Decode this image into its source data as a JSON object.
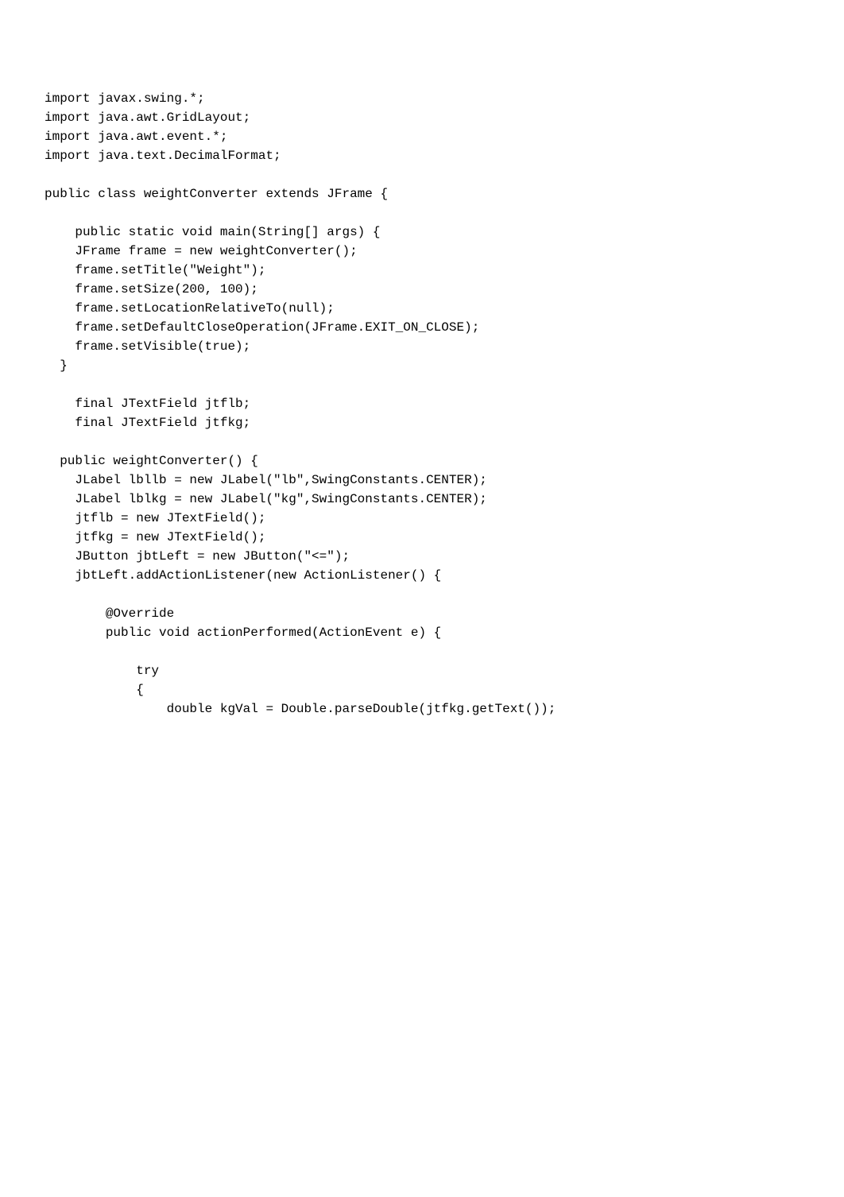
{
  "code": {
    "lines": [
      "import javax.swing.*;",
      "import java.awt.GridLayout;",
      "import java.awt.event.*;",
      "import java.text.DecimalFormat;",
      "",
      "public class weightConverter extends JFrame {",
      "",
      "    public static void main(String[] args) {",
      "    JFrame frame = new weightConverter();",
      "    frame.setTitle(\"Weight\");",
      "    frame.setSize(200, 100);",
      "    frame.setLocationRelativeTo(null);",
      "    frame.setDefaultCloseOperation(JFrame.EXIT_ON_CLOSE);",
      "    frame.setVisible(true);",
      "  }",
      "",
      "    final JTextField jtflb;",
      "    final JTextField jtfkg;",
      "",
      "  public weightConverter() {",
      "    JLabel lbllb = new JLabel(\"lb\",SwingConstants.CENTER);",
      "    JLabel lblkg = new JLabel(\"kg\",SwingConstants.CENTER);",
      "    jtflb = new JTextField();",
      "    jtfkg = new JTextField();",
      "    JButton jbtLeft = new JButton(\"<=\");",
      "    jbtLeft.addActionListener(new ActionListener() {",
      "",
      "        @Override",
      "        public void actionPerformed(ActionEvent e) {",
      "",
      "            try",
      "            {",
      "                double kgVal = Double.parseDouble(jtfkg.getText());"
    ]
  }
}
